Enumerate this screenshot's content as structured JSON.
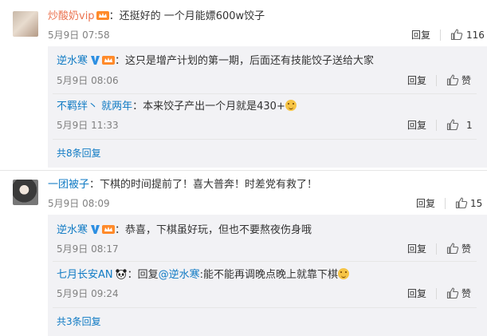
{
  "thread1": {
    "comment": {
      "username": "炒酸奶vip",
      "text": "：还挺好的 一个月能嫖600w饺子",
      "time": "5月9日 07:58",
      "reply_label": "回复",
      "likes": "116"
    },
    "replies": [
      {
        "username": "逆水寒",
        "text": "：这只是增产计划的第一期，后面还有技能饺子送给大家",
        "time": "5月9日 08:06",
        "reply_label": "回复",
        "like_label": "赞"
      },
      {
        "username": "不羁绊丶 就两年",
        "text": "：本来饺子产出一个月就是430+",
        "time": "5月9日 11:33",
        "reply_label": "回复",
        "likes": "1"
      }
    ],
    "more_replies": "共8条回复"
  },
  "thread2": {
    "comment": {
      "username": "一团被子",
      "text": "：下棋的时间提前了！喜大普奔！时差党有救了！",
      "time": "5月9日 08:09",
      "reply_label": "回复",
      "likes": "15"
    },
    "replies": [
      {
        "username": "逆水寒",
        "text": "：恭喜，下棋虽好玩，但也不要熬夜伤身哦",
        "time": "5月9日 08:17",
        "reply_label": "回复",
        "like_label": "赞"
      },
      {
        "username": "七月长安AN",
        "text_prefix": "：回复",
        "mention": "@逆水寒",
        "text": ":能不能再调晚点晚上就靠下棋",
        "time": "5月9日 09:24",
        "reply_label": "回复",
        "like_label": "赞"
      }
    ],
    "more_replies": "共3条回复"
  },
  "icons": {
    "like": "thumbs-up-icon",
    "verified": "verified-v-icon",
    "vip": "vip-crown-icon",
    "emoji": "emoji-icon",
    "panda": "panda-icon"
  },
  "colors": {
    "vip_name": "#eb7350",
    "link": "#0f7ac4",
    "meta": "#808080",
    "reply_bg": "#f2f2f5"
  }
}
